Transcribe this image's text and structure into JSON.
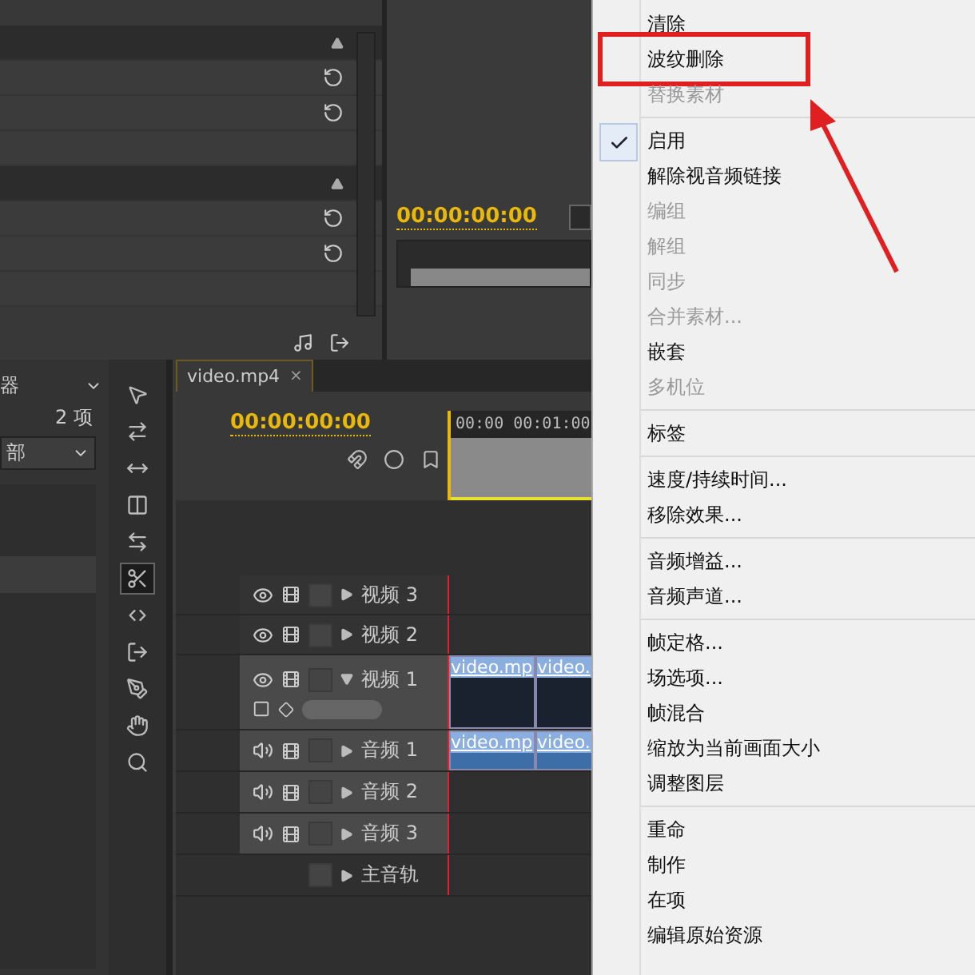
{
  "effect_panel": {
    "rows": [
      {
        "kind": "header"
      },
      {
        "kind": "param"
      },
      {
        "kind": "param"
      },
      {
        "kind": "blank"
      },
      {
        "kind": "header"
      },
      {
        "kind": "param"
      },
      {
        "kind": "param"
      },
      {
        "kind": "blank"
      }
    ]
  },
  "program_monitor": {
    "timecode": "00:00:00:00"
  },
  "project_panel": {
    "tab": "器",
    "count": "2 项",
    "filter": "部"
  },
  "tools": [
    {
      "kind": "select",
      "selected": false
    },
    {
      "kind": "track",
      "selected": false
    },
    {
      "kind": "ripple",
      "selected": false
    },
    {
      "kind": "rolling",
      "selected": false
    },
    {
      "kind": "rate",
      "selected": false
    },
    {
      "kind": "razor",
      "selected": true
    },
    {
      "kind": "slip",
      "selected": false
    },
    {
      "kind": "slide",
      "selected": false
    },
    {
      "kind": "pen",
      "selected": false
    },
    {
      "kind": "hand",
      "selected": false
    },
    {
      "kind": "zoom",
      "selected": false
    }
  ],
  "timeline": {
    "tab": "video.mp4",
    "close": "×",
    "timecode": "00:00:00:00",
    "ruler": [
      "00:00",
      "00:01:00"
    ],
    "tracks": [
      {
        "kind": "video",
        "name": "视频 3",
        "expanded": false
      },
      {
        "kind": "video",
        "name": "视频 2",
        "expanded": false
      },
      {
        "kind": "video",
        "name": "视频 1",
        "expanded": true,
        "clips": [
          "video.mp",
          "video."
        ]
      },
      {
        "kind": "audio",
        "name": "音频 1",
        "expanded": false,
        "clips": [
          "video.mp",
          "video."
        ]
      },
      {
        "kind": "audio",
        "name": "音频 2",
        "expanded": false
      },
      {
        "kind": "audio",
        "name": "音频 3",
        "expanded": false
      },
      {
        "kind": "master",
        "name": "主音轨",
        "expanded": false
      }
    ]
  },
  "context_menu": {
    "groups": [
      [
        {
          "label": "清除",
          "disabled": false,
          "checked": false,
          "annotated": false
        },
        {
          "label": "波纹删除",
          "disabled": false,
          "checked": false,
          "annotated": true
        },
        {
          "label": "替换素材",
          "disabled": true,
          "checked": false,
          "annotated": false
        }
      ],
      [
        {
          "label": "启用",
          "disabled": false,
          "checked": true,
          "annotated": false
        },
        {
          "label": "解除视音频链接",
          "disabled": false,
          "checked": false,
          "annotated": false
        },
        {
          "label": "编组",
          "disabled": true,
          "checked": false,
          "annotated": false
        },
        {
          "label": "解组",
          "disabled": true,
          "checked": false,
          "annotated": false
        },
        {
          "label": "同步",
          "disabled": true,
          "checked": false,
          "annotated": false
        },
        {
          "label": "合并素材...",
          "disabled": true,
          "checked": false,
          "annotated": false
        },
        {
          "label": "嵌套",
          "disabled": false,
          "checked": false,
          "annotated": false
        },
        {
          "label": "多机位",
          "disabled": true,
          "checked": false,
          "annotated": false
        }
      ],
      [
        {
          "label": "标签",
          "disabled": false,
          "checked": false,
          "annotated": false
        }
      ],
      [
        {
          "label": "速度/持续时间...",
          "disabled": false,
          "checked": false,
          "annotated": false
        },
        {
          "label": "移除效果...",
          "disabled": false,
          "checked": false,
          "annotated": false
        }
      ],
      [
        {
          "label": "音频增益...",
          "disabled": false,
          "checked": false,
          "annotated": false
        },
        {
          "label": "音频声道...",
          "disabled": false,
          "checked": false,
          "annotated": false
        }
      ],
      [
        {
          "label": "帧定格...",
          "disabled": false,
          "checked": false,
          "annotated": false
        },
        {
          "label": "场选项...",
          "disabled": false,
          "checked": false,
          "annotated": false
        },
        {
          "label": "帧混合",
          "disabled": false,
          "checked": false,
          "annotated": false
        },
        {
          "label": "缩放为当前画面大小",
          "disabled": false,
          "checked": false,
          "annotated": false
        },
        {
          "label": "调整图层",
          "disabled": false,
          "checked": false,
          "annotated": false
        }
      ],
      [
        {
          "label": "重命",
          "disabled": false,
          "checked": false,
          "annotated": false
        },
        {
          "label": "制作",
          "disabled": false,
          "checked": false,
          "annotated": false
        },
        {
          "label": "在项",
          "disabled": false,
          "checked": false,
          "annotated": false
        },
        {
          "label": "编辑原始资源",
          "disabled": false,
          "checked": false,
          "annotated": false
        }
      ]
    ]
  }
}
